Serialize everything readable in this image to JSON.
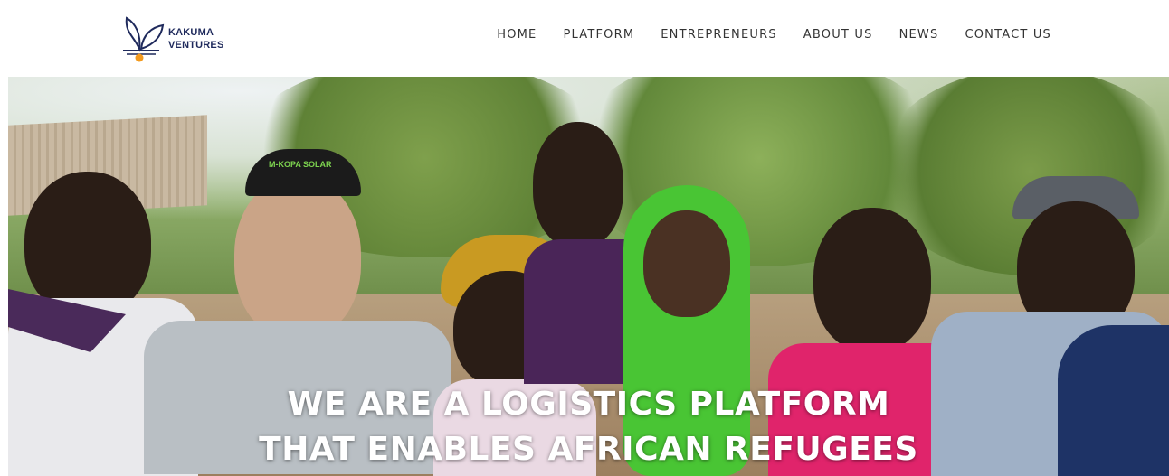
{
  "brand": {
    "line1": "KAKUMA",
    "line2": "VENTURES",
    "colors": {
      "navy": "#1f2a5c",
      "orange": "#f39a1e"
    }
  },
  "nav": {
    "items": [
      {
        "label": "HOME"
      },
      {
        "label": "PLATFORM"
      },
      {
        "label": "ENTREPRENEURS"
      },
      {
        "label": "ABOUT US"
      },
      {
        "label": "NEWS"
      },
      {
        "label": "CONTACT US"
      }
    ]
  },
  "hero": {
    "headline_line1": "WE ARE A LOGISTICS PLATFORM",
    "headline_line2": "THAT ENABLES AFRICAN REFUGEES",
    "cap_text": "M-KOPA SOLAR"
  }
}
